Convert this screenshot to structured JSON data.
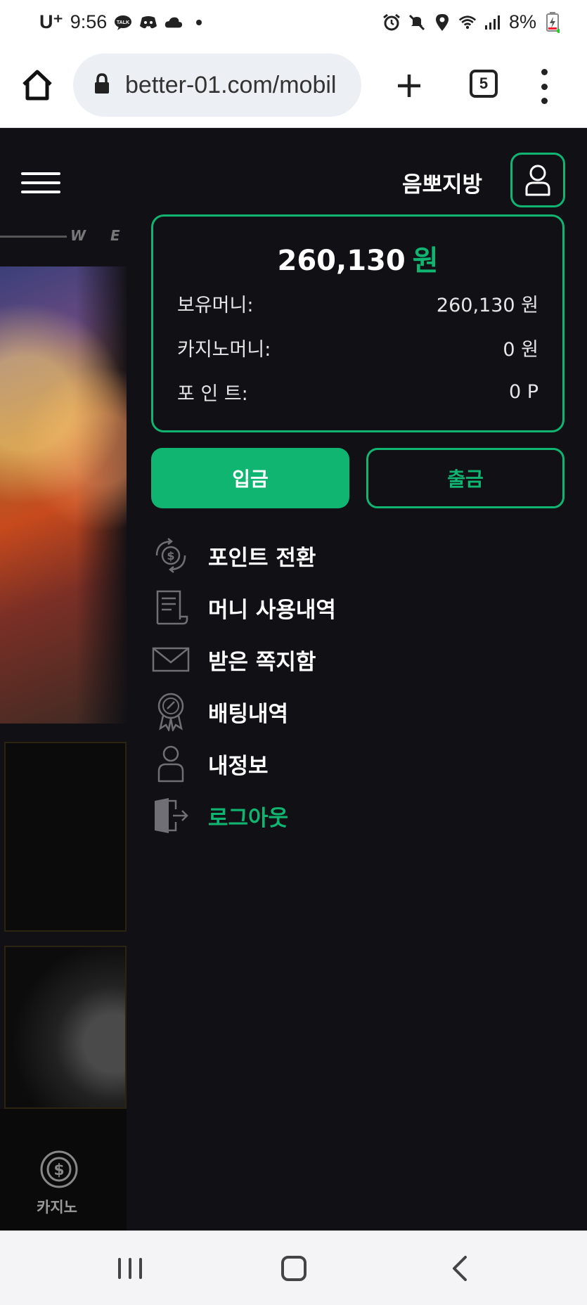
{
  "status_bar": {
    "carrier": "U⁺",
    "time": "9:56",
    "battery": "8%"
  },
  "browser": {
    "url": "better-01.com/mobil",
    "tab_count": "5"
  },
  "header": {
    "username": "음뽀지방"
  },
  "background": {
    "marquee_text": "W E",
    "bottom_nav_label": "카지노"
  },
  "balance": {
    "total_amount": "260,130",
    "total_currency": "원",
    "rows": [
      {
        "label": "보유머니:",
        "value": "260,130 원"
      },
      {
        "label": "카지노머니:",
        "value": "0 원"
      },
      {
        "label": "포 인 트:",
        "value": "0 P"
      }
    ]
  },
  "actions": {
    "deposit_label": "입금",
    "withdraw_label": "출금"
  },
  "menu": {
    "items": [
      {
        "label": "포인트 전환",
        "icon": "point-exchange-icon"
      },
      {
        "label": "머니 사용내역",
        "icon": "receipt-icon"
      },
      {
        "label": "받은 쪽지함",
        "icon": "envelope-icon"
      },
      {
        "label": "배팅내역",
        "icon": "badge-icon"
      },
      {
        "label": "내정보",
        "icon": "user-icon"
      },
      {
        "label": "로그아웃",
        "icon": "logout-icon"
      }
    ]
  },
  "colors": {
    "accent": "#10b572",
    "background": "#111014"
  }
}
